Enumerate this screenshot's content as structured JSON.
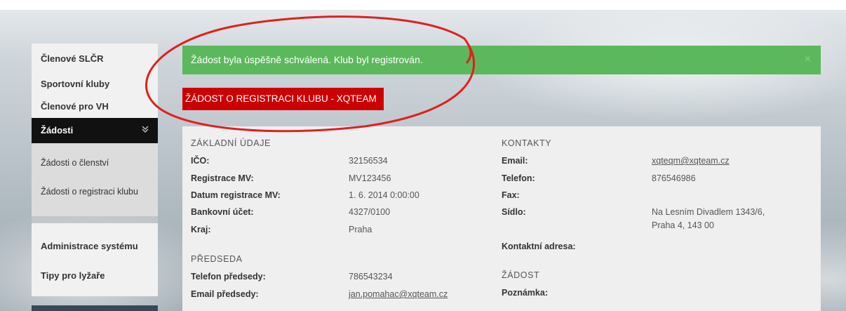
{
  "sidebar": {
    "items_top": [
      "Členové SLČR",
      "Sportovní kluby",
      "Členové pro VH"
    ],
    "active": "Žádosti",
    "sub_items": [
      "Žádosti o členství",
      "Žádosti o registraci klubu"
    ],
    "items_bottom": [
      "Administrace systému",
      "Tipy pro lyžaře"
    ]
  },
  "alert": {
    "text": "Žádost byla úspěšně schválená. Klub byl registrován.",
    "close": "×"
  },
  "page_title": "ŽÁDOST O REGISTRACI KLUBU - XQTEAM",
  "basic": {
    "heading": "ZÁKLADNÍ ÚDAJE",
    "rows": [
      {
        "label": "IČO:",
        "value": "32156534"
      },
      {
        "label": "Registrace MV:",
        "value": "MV123456"
      },
      {
        "label": "Datum registrace MV:",
        "value": "1. 6. 2014 0:00:00"
      },
      {
        "label": "Bankovní účet:",
        "value": "4327/0100"
      },
      {
        "label": "Kraj:",
        "value": "Praha"
      }
    ]
  },
  "chair": {
    "heading": "PŘEDSEDA",
    "rows": [
      {
        "label": "Telefon předsedy:",
        "value": "786543234"
      },
      {
        "label": "Email předsedy:",
        "value": "jan.pomahac@xqteam.cz"
      }
    ]
  },
  "contacts": {
    "heading": "KONTAKTY",
    "email_label": "Email:",
    "email": "xqteqm@xqteam.cz",
    "phone_label": "Telefon:",
    "phone": "876546986",
    "fax_label": "Fax:",
    "seat_label": "Sídlo:",
    "seat_line1": "Na Lesním Divadlem 1343/6,",
    "seat_line2": "Praha 4, 143 00",
    "contact_addr_label": "Kontaktní adresa:"
  },
  "request": {
    "heading": "ŽÁDOST",
    "note_label": "Poznámka:"
  },
  "colors": {
    "alert_green": "#5cb85c",
    "title_red": "#cc0000",
    "annotation_red": "#e0201e",
    "active_bg": "#111111"
  }
}
